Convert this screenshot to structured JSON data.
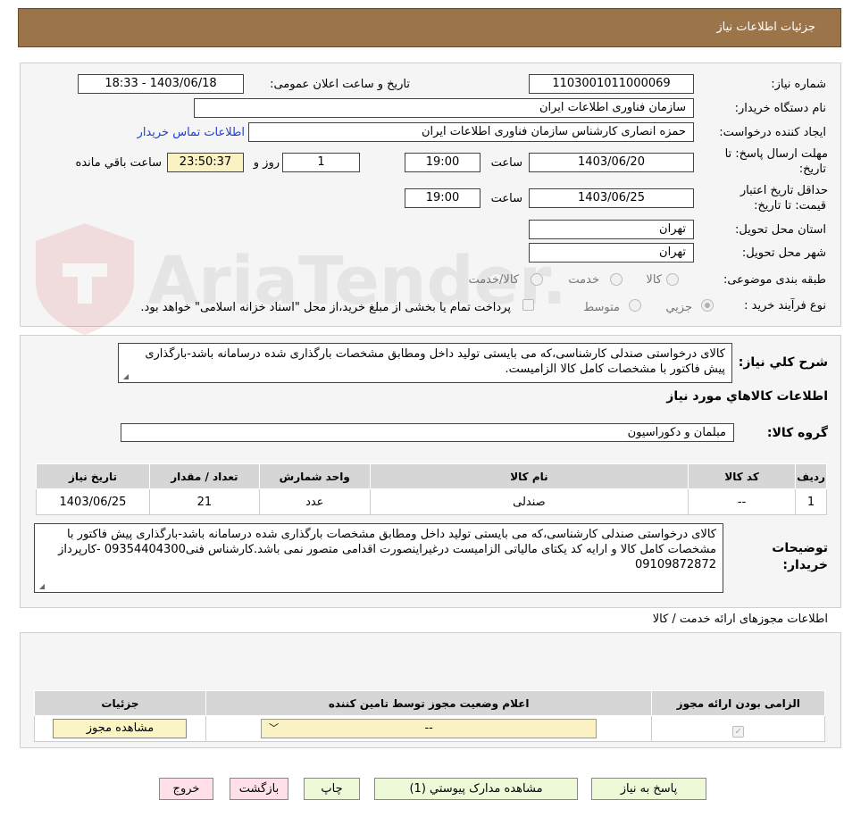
{
  "header": {
    "title": "جزئیات اطلاعات نیاز"
  },
  "form": {
    "need_number_label": "شماره نیاز:",
    "need_number": "1103001011000069",
    "announce_label": "تاریخ و ساعت اعلان عمومی:",
    "announce_value": "1403/06/18 - 18:33",
    "buyer_org_label": "نام دستگاه خريدار:",
    "buyer_org": "سازمان فناوری اطلاعات ایران",
    "requester_label": "ایجاد کننده درخواست:",
    "requester": "حمزه انصاری کارشناس سازمان فناوری اطلاعات ایران",
    "contact_link": "اطلاعات تماس خريدار",
    "deadline_label_line1": "مهلت ارسال پاسخ: تا",
    "deadline_label_line2": "تاریخ:",
    "deadline_date": "1403/06/20",
    "time_label": "ساعت",
    "deadline_time": "19:00",
    "days_value": "1",
    "days_label": "روز و",
    "remaining_time": "23:50:37",
    "remaining_label": "ساعت باقي مانده",
    "validity_label_line1": "حداقل تاریخ اعتبار",
    "validity_label_line2": "قیمت: تا تاریخ:",
    "validity_date": "1403/06/25",
    "validity_time": "19:00",
    "province_label": "استان محل تحویل:",
    "province": "تهران",
    "city_label": "شهر محل تحویل:",
    "city": "تهران",
    "category_label": "طبقه بندی موضوعی:",
    "category_options": [
      "کالا",
      "خدمت",
      "کالا/خدمت"
    ],
    "process_label": "نوع فرآیند خرید :",
    "process_options": [
      "جزيي",
      "متوسط"
    ],
    "payment_note": "پرداخت تمام یا بخشی از مبلغ خرید،از محل \"اسناد خزانه اسلامی\" خواهد بود."
  },
  "description": {
    "label": "شرح کلي نياز:",
    "text": "کالای درخواستی صندلی کارشناسی،که می بایستی تولید داخل ومطابق مشخصات بارگذاری شده درسامانه باشد-بارگذاری پیش فاکتور با مشخصات کامل کالا الزامیست."
  },
  "goods": {
    "section_title": "اطلاعات کالاهاي مورد نياز",
    "group_label": "گروه کالا:",
    "group_value": "مبلمان و دکوراسیون",
    "columns": [
      "رديف",
      "کد کالا",
      "نام کالا",
      "واحد شمارش",
      "تعداد / مقدار",
      "تاریخ نیاز"
    ],
    "rows": [
      [
        "1",
        "--",
        "صندلی",
        "عدد",
        "21",
        "1403/06/25"
      ]
    ]
  },
  "buyer_notes": {
    "label_line1": "توضيحات",
    "label_line2": "خريدار:",
    "text": "کالای درخواستی صندلی کارشناسی،که می بایستی تولید داخل ومطابق مشخصات بارگذاری شده درسامانه باشد-بارگذاری پیش فاکتور با مشخصات کامل کالا و ارایه کد یکتای مالیاتی الزامیست درغیراینصورت اقدامی متصور نمی باشد.کارشناس فنی09354404300 -کارپرداز 09109872872"
  },
  "permits": {
    "section_title": "اطلاعات مجوزهای ارائه خدمت / کالا",
    "columns": [
      "الزامی بودن ارائه مجوز",
      "اعلام وضعیت مجوز توسط تامین کننده",
      "جزئیات"
    ],
    "select_value": "--",
    "view_button": "مشاهده مجوز"
  },
  "buttons": {
    "reply": "پاسخ به نیاز",
    "attachments": "مشاهده مدارک پیوستي (1)",
    "print": "چاپ",
    "back": "بازگشت",
    "exit": "خروج"
  },
  "watermark": {
    "text": "AriaTender.neT"
  },
  "colors": {
    "header_bg": "#9b7449",
    "link": "#1f3fd1",
    "time_bg": "#fbf2c4",
    "table_header": "#d6d6d6"
  }
}
